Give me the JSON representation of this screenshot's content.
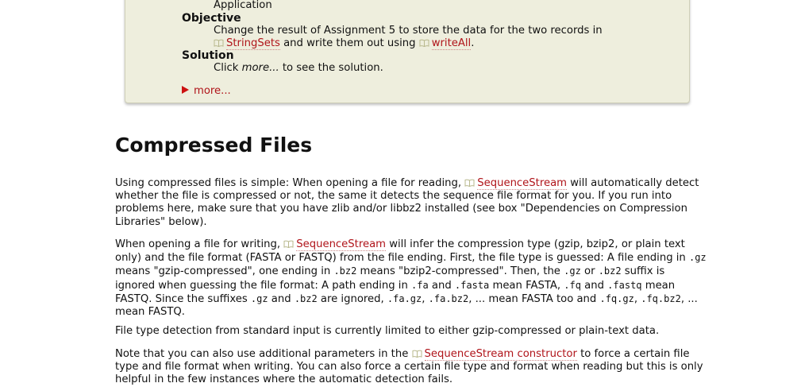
{
  "assignment": {
    "application_label": "Application",
    "objective_label": "Objective",
    "objective_pre": "Change the result of Assignment 5 to store the data for the two records in",
    "objective_link1": "StringSets",
    "objective_mid": " and write them out using ",
    "objective_link2": "writeAll",
    "objective_end": ".",
    "solution_label": "Solution",
    "solution_pre": "Click ",
    "solution_em": "more...",
    "solution_post": " to see the solution.",
    "more_label": "more..."
  },
  "section": {
    "title": "Compressed Files",
    "p1": {
      "a": "Using compressed files is simple: When opening a file for reading, ",
      "link": "SequenceStream",
      "b": " will automatically detect whether the file is compressed or not, the same it detects the sequence file format for you. If you run into problems here, make sure that you have zlib and/or libbz2 installed (see box \"Dependencies on Compression Libraries\" below)."
    },
    "p2": {
      "a": "When opening a file for writing, ",
      "link": "SequenceStream",
      "b": " will infer the compression type (gzip, bzip2, or plain text only) and the file format (FASTA or FASTQ) from the file ending. First, the file type is guessed: A file ending in ",
      "c1": ".gz",
      "b2": " means \"gzip-compressed\", one ending in ",
      "c2": ".bz2",
      "b3": " means \"bzip2-compressed\". Then, the ",
      "c3": ".gz",
      "b4": " or ",
      "c4": ".bz2",
      "b5": " suffix is ignored when guessing the file format: A path ending in ",
      "c5": ".fa",
      "b6": " and ",
      "c6": ".fasta",
      "b7": " mean FASTA, ",
      "c7": ".fq",
      "b8": " and ",
      "c8": ".fastq",
      "b9": " mean FASTQ. Since the suffixes ",
      "c9": ".gz",
      "b10": " and ",
      "c10": ".bz2",
      "b11": " are ignored, ",
      "c11": ".fa.gz",
      "b12": ", ",
      "c12": ".fa.bz2",
      "b13": ", ... mean FASTA too and ",
      "c13": ".fq.gz",
      "b14": ", ",
      "c14": ".fq.bz2",
      "b15": ", ... mean FASTQ."
    },
    "p3": "File type detection from standard input is currently limited to either gzip-compressed or plain-text data.",
    "p4": {
      "a": "Note that you can also use additional parameters in the ",
      "link": "SequenceStream constructor",
      "b": " to force a certain file type and file format when writing. You can also force a certain file type and format when reading but this is only helpful in the few instances where the automatic detection fails."
    }
  },
  "colors": {
    "link": "#b0141a",
    "box_bg": "#eeeedd",
    "more_triangle": "#cc1111"
  },
  "icons": {
    "doc_link": "book-icon",
    "expand": "triangle-right-icon"
  }
}
